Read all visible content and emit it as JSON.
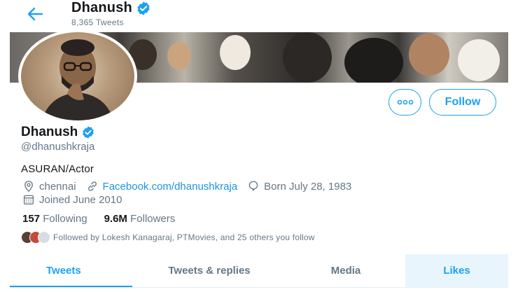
{
  "header": {
    "name": "Dhanush",
    "tweet_count": "8,365 Tweets"
  },
  "profile": {
    "name": "Dhanush",
    "handle": "@dhanushkraja",
    "bio": "ASURAN/Actor",
    "location": "chennai",
    "website": "Facebook.com/dhanushkraja",
    "birthday": "Born July 28, 1983",
    "joined": "Joined June 2010",
    "following_count": "157",
    "following_label": "Following",
    "followers_count": "9.6M",
    "followers_label": "Followers",
    "followed_by": "Followed by Lokesh Kanagaraj, PTMovies, and 25 others you follow"
  },
  "actions": {
    "follow_label": "Follow"
  },
  "tabs": [
    {
      "label": "Tweets"
    },
    {
      "label": "Tweets & replies"
    },
    {
      "label": "Media"
    },
    {
      "label": "Likes"
    }
  ],
  "colors": {
    "accent": "#1da1f2",
    "text_secondary": "#657786"
  }
}
